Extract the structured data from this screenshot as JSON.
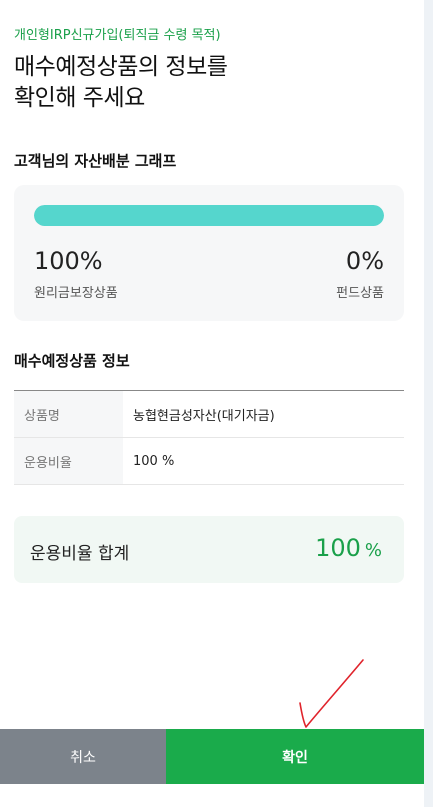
{
  "header": {
    "breadcrumb": "개인형IRP신규가입(퇴직금 수령 목적)",
    "title_line1": "매수예정상품의 정보를",
    "title_line2": "확인해 주세요"
  },
  "allocation": {
    "section_title": "고객님의 자산배분 그래프",
    "principal_share": 100,
    "left": {
      "percent": "100%",
      "label": "원리금보장상품"
    },
    "right": {
      "percent": "0%",
      "label": "펀드상품"
    },
    "colors": {
      "fill": "#55d6cd",
      "track": "#e3e6ea"
    }
  },
  "product_info": {
    "section_title": "매수예정상품 정보",
    "rows": [
      {
        "key": "상품명",
        "value": "농협현금성자산(대기자금)"
      },
      {
        "key": "운용비율",
        "value": "100 %"
      }
    ]
  },
  "summary": {
    "label": "운용비율 합계",
    "value": "100",
    "unit": "%",
    "accent": "#1aa04a"
  },
  "footer": {
    "cancel_label": "취소",
    "confirm_label": "확인"
  }
}
